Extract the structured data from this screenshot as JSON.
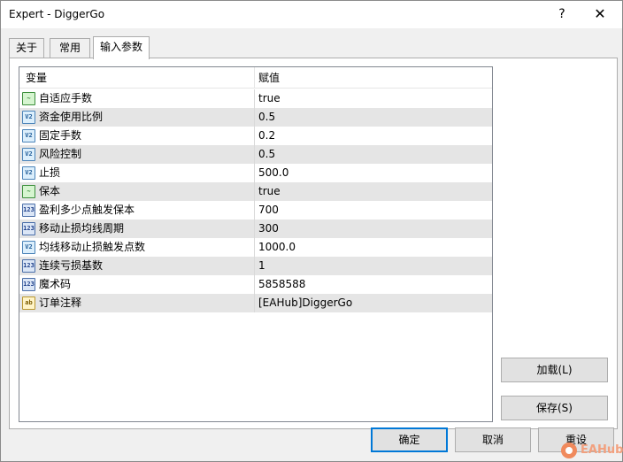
{
  "window": {
    "title": "Expert - DiggerGo",
    "help_glyph": "?",
    "close_glyph": "✕"
  },
  "tabs": [
    {
      "label": "关于",
      "active": false
    },
    {
      "label": "常用",
      "active": false
    },
    {
      "label": "输入参数",
      "active": true
    }
  ],
  "grid": {
    "col_variable": "变量",
    "col_value": "赋值",
    "rows": [
      {
        "name": "自适应手数",
        "value": "true",
        "type": "bool",
        "icon": "bool-icon"
      },
      {
        "name": "资金使用比例",
        "value": "0.5",
        "type": "double",
        "icon": "double-icon"
      },
      {
        "name": "固定手数",
        "value": "0.2",
        "type": "double",
        "icon": "double-icon"
      },
      {
        "name": "风险控制",
        "value": "0.5",
        "type": "double",
        "icon": "double-icon"
      },
      {
        "name": "止损",
        "value": "500.0",
        "type": "double",
        "icon": "double-icon"
      },
      {
        "name": "保本",
        "value": "true",
        "type": "bool",
        "icon": "bool-icon"
      },
      {
        "name": "盈利多少点触发保本",
        "value": "700",
        "type": "int",
        "icon": "int-icon"
      },
      {
        "name": "移动止损均线周期",
        "value": "300",
        "type": "int",
        "icon": "int-icon"
      },
      {
        "name": "均线移动止损触发点数",
        "value": "1000.0",
        "type": "double",
        "icon": "double-icon"
      },
      {
        "name": "连续亏损基数",
        "value": "1",
        "type": "int",
        "icon": "int-icon"
      },
      {
        "name": "魔术码",
        "value": "5858588",
        "type": "int",
        "icon": "int-icon"
      },
      {
        "name": "订单注释",
        "value": "[EAHub]DiggerGo",
        "type": "string",
        "icon": "string-icon"
      }
    ]
  },
  "icons": {
    "bool": "~",
    "double": "V2",
    "int": "123",
    "string": "ab"
  },
  "buttons": {
    "load": "加载(L)",
    "save": "保存(S)",
    "ok": "确定",
    "cancel": "取消",
    "reset": "重设"
  },
  "watermark": {
    "text": "EAHub"
  },
  "colors": {
    "row_alt": "#e5e5e5",
    "primary_border": "#0078d7"
  }
}
